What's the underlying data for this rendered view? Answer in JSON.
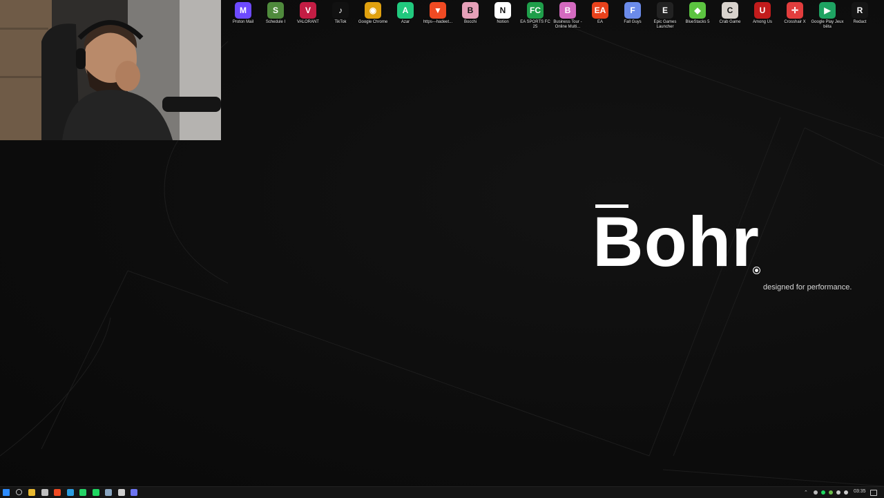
{
  "desktop": {
    "icons": [
      {
        "label": "Proton Mail",
        "icon": "proton-mail-icon",
        "color": "#6d4aff",
        "glyph": "M"
      },
      {
        "label": "Schedule I",
        "icon": "schedule-one-icon",
        "color": "#4f8a3c",
        "glyph": "S"
      },
      {
        "label": "VALORANT",
        "icon": "valorant-icon",
        "color": "#c31d44",
        "glyph": "V"
      },
      {
        "label": "TikTok",
        "icon": "tiktok-icon",
        "color": "#111111",
        "glyph": "♪"
      },
      {
        "label": "Google Chrome",
        "icon": "chrome-icon",
        "color": "#e0a10f",
        "glyph": "◉"
      },
      {
        "label": "Azar",
        "icon": "azar-icon",
        "color": "#21c97e",
        "glyph": "A"
      },
      {
        "label": "https---hadeet...",
        "icon": "brave-icon",
        "color": "#f04a23",
        "glyph": "▼"
      },
      {
        "label": "Bocchi",
        "icon": "bocchi-icon",
        "color": "#e6a0b8",
        "glyph": "B"
      },
      {
        "label": "Notion",
        "icon": "notion-icon",
        "color": "#ffffff",
        "glyph": "N"
      },
      {
        "label": "EA SPORTS FC 25",
        "icon": "ea-fc-icon",
        "color": "#1f9e4a",
        "glyph": "FC"
      },
      {
        "label": "Business Tour - Online Multi...",
        "icon": "business-tour-icon",
        "color": "#d46ac0",
        "glyph": "B"
      },
      {
        "label": "EA",
        "icon": "ea-icon",
        "color": "#e8421c",
        "glyph": "EA"
      },
      {
        "label": "Fall Guys",
        "icon": "fall-guys-icon",
        "color": "#6b8bea",
        "glyph": "F"
      },
      {
        "label": "Epic Games Launcher",
        "icon": "epic-games-icon",
        "color": "#222222",
        "glyph": "E"
      },
      {
        "label": "BlueStacks 5",
        "icon": "bluestacks-icon",
        "color": "#5cc440",
        "glyph": "◆"
      },
      {
        "label": "Crab Game",
        "icon": "crab-game-icon",
        "color": "#d8d2cc",
        "glyph": "C"
      },
      {
        "label": "Among Us",
        "icon": "among-us-icon",
        "color": "#c21c1c",
        "glyph": "U"
      },
      {
        "label": "Crosshair X",
        "icon": "crosshair-x-icon",
        "color": "#e23d3d",
        "glyph": "✛"
      },
      {
        "label": "Google Play Jeux bêta",
        "icon": "google-play-games-icon",
        "color": "#1ea362",
        "glyph": "▶"
      },
      {
        "label": "Redact",
        "icon": "redact-icon",
        "color": "#151515",
        "glyph": "R"
      }
    ]
  },
  "wallpaper": {
    "logo_text": "Bohr",
    "tagline": "designed for performance."
  },
  "taskbar": {
    "clock": "03:35",
    "apps": [
      {
        "icon": "start-icon",
        "color": "#2d8cff"
      },
      {
        "icon": "search-icon",
        "color": "#cccccc"
      },
      {
        "icon": "file-explorer-icon",
        "color": "#e8b830"
      },
      {
        "icon": "notepad-icon",
        "color": "#bfbfbf"
      },
      {
        "icon": "brave-icon",
        "color": "#f04a23"
      },
      {
        "icon": "edge-icon",
        "color": "#2b9de0"
      },
      {
        "icon": "whatsapp-icon",
        "color": "#25d366"
      },
      {
        "icon": "spotify-icon",
        "color": "#1ed760"
      },
      {
        "icon": "steam-icon",
        "color": "#8aa6c1"
      },
      {
        "icon": "obs-icon",
        "color": "#cfcfcf"
      },
      {
        "icon": "discord-icon",
        "color": "#6d75f2"
      }
    ]
  }
}
